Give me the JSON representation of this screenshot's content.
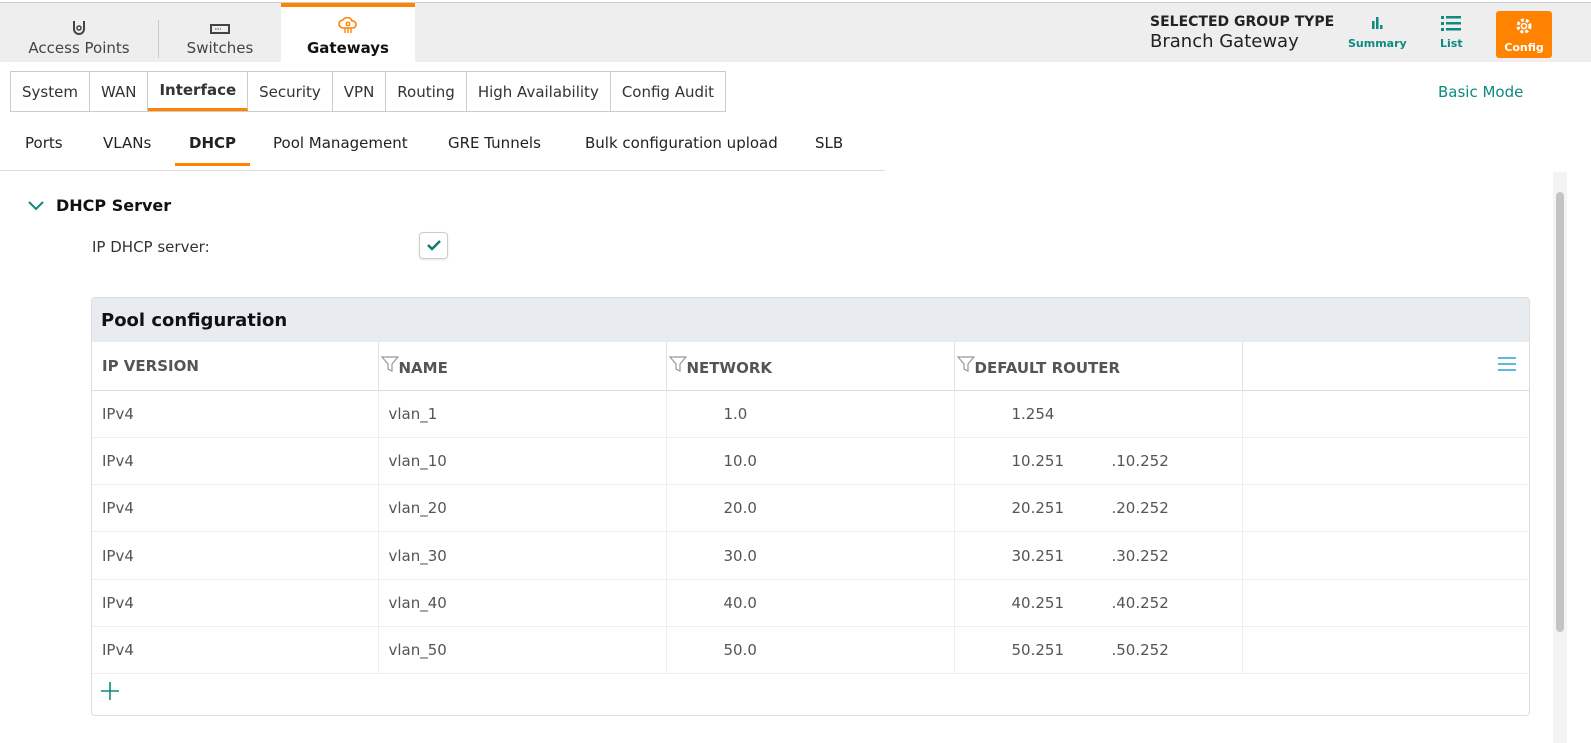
{
  "product_tabs": [
    {
      "label": "Access Points",
      "icon": "access-point-icon"
    },
    {
      "label": "Switches",
      "icon": "switch-icon"
    },
    {
      "label": "Gateways",
      "icon": "gateway-icon"
    }
  ],
  "group_type": {
    "heading": "SELECTED GROUP TYPE",
    "value": "Branch Gateway"
  },
  "views": {
    "summary": "Summary",
    "list": "List",
    "config": "Config"
  },
  "section_tabs": [
    "System",
    "WAN",
    "Interface",
    "Security",
    "VPN",
    "Routing",
    "High Availability",
    "Config Audit"
  ],
  "basic_mode": "Basic Mode",
  "sub_tabs": [
    "Ports",
    "VLANs",
    "DHCP",
    "Pool Management",
    "GRE Tunnels",
    "Bulk configuration upload",
    "SLB"
  ],
  "dhcp": {
    "title": "DHCP Server",
    "ip_dhcp_label": "IP DHCP server:",
    "ip_dhcp_checked": true
  },
  "pool": {
    "title": "Pool configuration",
    "columns": [
      "IP VERSION",
      "NAME",
      "NETWORK",
      "DEFAULT ROUTER"
    ],
    "rows": [
      {
        "ip": "IPv4",
        "name": "vlan_1",
        "network": "1.0",
        "router": "1.254",
        "router2": ""
      },
      {
        "ip": "IPv4",
        "name": "vlan_10",
        "network": "10.0",
        "router": "10.251",
        "router2": ".10.252"
      },
      {
        "ip": "IPv4",
        "name": "vlan_20",
        "network": "20.0",
        "router": "20.251",
        "router2": ".20.252"
      },
      {
        "ip": "IPv4",
        "name": "vlan_30",
        "network": "30.0",
        "router": "30.251",
        "router2": ".30.252"
      },
      {
        "ip": "IPv4",
        "name": "vlan_40",
        "network": "40.0",
        "router": "40.251",
        "router2": ".40.252"
      },
      {
        "ip": "IPv4",
        "name": "vlan_50",
        "network": "50.0",
        "router": "50.251",
        "router2": ".50.252"
      }
    ]
  },
  "colors": {
    "accent": "#ff8300",
    "teal": "#0e8a7f"
  }
}
